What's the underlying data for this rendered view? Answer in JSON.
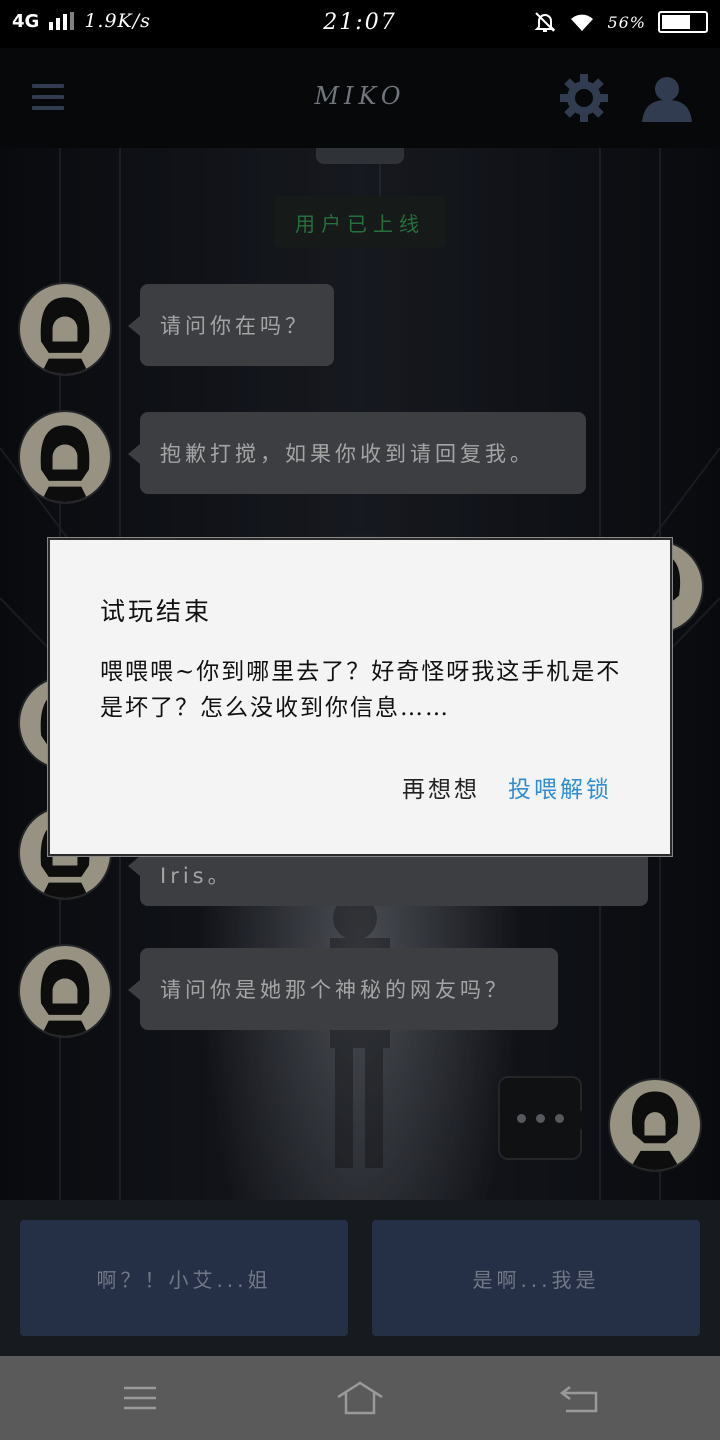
{
  "status_bar": {
    "network": "4G",
    "speed": "1.9K/s",
    "time": "21:07",
    "battery": "56%",
    "battery_level": 0.56
  },
  "header": {
    "title": "MIKO",
    "accent": "#3c4a63"
  },
  "chat": {
    "system_notice": "用户已上线",
    "messages": [
      {
        "text": "请问你在吗？"
      },
      {
        "text": "抱歉打搅，如果你收到请回复我。"
      },
      {
        "text": "Iris。"
      },
      {
        "text": "请问你是她那个神秘的网友吗？"
      }
    ]
  },
  "replies": [
    {
      "label": "啊？！小艾...姐"
    },
    {
      "label": "是啊...我是"
    }
  ],
  "dialog": {
    "title": "试玩结束",
    "message": "喂喂喂~你到哪里去了？好奇怪呀我这手机是不是坏了？怎么没收到你信息……",
    "cancel_label": "再想想",
    "confirm_label": "投喂解锁",
    "confirm_color": "#2f8ed6"
  }
}
